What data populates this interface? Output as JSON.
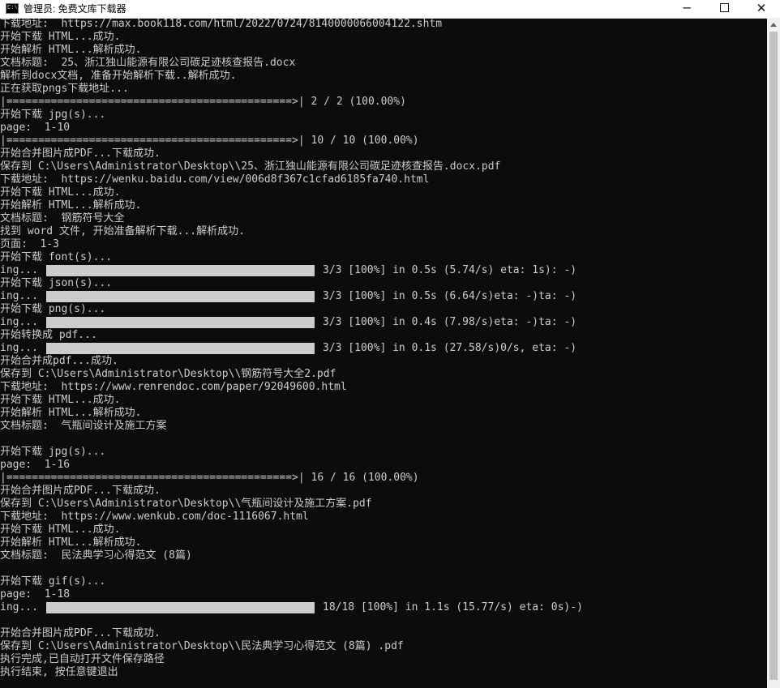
{
  "window": {
    "title": "管理员: 免费文库下载器",
    "icon_label": "C:\\",
    "minimize_label": "─",
    "close_label": "✕"
  },
  "console": {
    "lines": [
      {
        "text": "下载地址:  https://max.book118.com/html/2022/0724/8140000066004122.shtm"
      },
      {
        "text": "开始下载 HTML...成功."
      },
      {
        "text": "开始解析 HTML...解析成功."
      },
      {
        "text": "文档标题:  25、浙江独山能源有限公司碳足迹核查报告.docx"
      },
      {
        "text": "解析到docx文档, 准备开始解析下载..解析成功."
      },
      {
        "text": "正在获取pngs下载地址..."
      },
      {
        "text": "|=============================================>| 2 / 2 (100.00%)"
      },
      {
        "text": "开始下载 jpg(s)..."
      },
      {
        "text": "page:  1-10"
      },
      {
        "text": "|=============================================>| 10 / 10 (100.00%)"
      },
      {
        "text": "开始合并图片成PDF...下载成功."
      },
      {
        "text": "保存到 C:\\Users\\Administrator\\Desktop\\\\25、浙江独山能源有限公司碳足迹核查报告.docx.pdf"
      },
      {
        "text": "下载地址:  https://wenku.baidu.com/view/006d8f367c1cfad6185fa740.html"
      },
      {
        "text": "开始下载 HTML...成功."
      },
      {
        "text": "开始解析 HTML...解析成功."
      },
      {
        "text": "文档标题:  钢筋符号大全"
      },
      {
        "text": "找到 word 文件, 开始准备解析下载...解析成功."
      },
      {
        "text": "页面:  1-3"
      },
      {
        "text": "开始下载 font(s)..."
      },
      {
        "text": "ing...  ",
        "progress": 1.0,
        "suffix": "3/3 [100%] in 0.5s (5.74/s) eta: 1s): -)"
      },
      {
        "text": "开始下载 json(s)..."
      },
      {
        "text": "ing...  ",
        "progress": 1.0,
        "suffix": "3/3 [100%] in 0.5s (6.64/s)eta: -)ta: -)"
      },
      {
        "text": "开始下载 png(s)..."
      },
      {
        "text": "ing...  ",
        "progress": 1.0,
        "suffix": "3/3 [100%] in 0.4s (7.98/s)eta: -)ta: -)"
      },
      {
        "text": "开始转换成 pdf..."
      },
      {
        "text": "ing...  ",
        "progress": 1.0,
        "suffix": "3/3 [100%] in 0.1s (27.58/s)0/s, eta: -)"
      },
      {
        "text": "开始合并成pdf...成功."
      },
      {
        "text": "保存到 C:\\Users\\Administrator\\Desktop\\\\钢筋符号大全2.pdf"
      },
      {
        "text": "下载地址:  https://www.renrendoc.com/paper/92049600.html"
      },
      {
        "text": "开始下载 HTML...成功."
      },
      {
        "text": "开始解析 HTML...解析成功."
      },
      {
        "text": "文档标题:  气瓶间设计及施工方案"
      },
      {
        "text": ""
      },
      {
        "text": "开始下载 jpg(s)..."
      },
      {
        "text": "page:  1-16"
      },
      {
        "text": "|=============================================>| 16 / 16 (100.00%)"
      },
      {
        "text": "开始合并图片成PDF...下载成功."
      },
      {
        "text": "保存到 C:\\Users\\Administrator\\Desktop\\\\气瓶间设计及施工方案.pdf"
      },
      {
        "text": "下载地址:  https://www.wenkub.com/doc-1116067.html"
      },
      {
        "text": "开始下载 HTML...成功."
      },
      {
        "text": "开始解析 HTML...解析成功."
      },
      {
        "text": "文档标题:  民法典学习心得范文 (8篇)"
      },
      {
        "text": ""
      },
      {
        "text": "开始下载 gif(s)..."
      },
      {
        "text": "page:  1-18"
      },
      {
        "text": "ing...  ",
        "progress": 1.0,
        "suffix": "18/18 [100%] in 1.1s (15.77/s) eta: 0s)-)"
      },
      {
        "text": ""
      },
      {
        "text": "开始合并图片成PDF...下载成功."
      },
      {
        "text": "保存到 C:\\Users\\Administrator\\Desktop\\\\民法典学习心得范文 (8篇) .pdf"
      },
      {
        "text": "执行完成,已自动打开文件保存路径"
      },
      {
        "text": "执行结束, 按任意键退出"
      }
    ]
  }
}
